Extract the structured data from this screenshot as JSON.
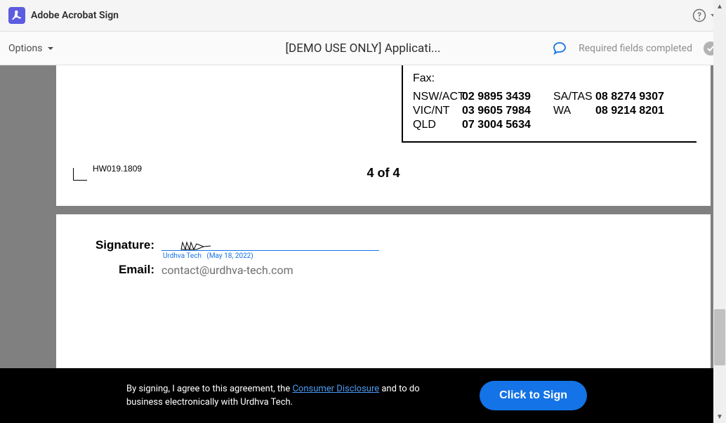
{
  "header": {
    "app_title": "Adobe Acrobat Sign"
  },
  "toolbar": {
    "options_label": "Options",
    "doc_title": "[DEMO USE ONLY] Applicati...",
    "status_text": "Required fields completed"
  },
  "document": {
    "fax_label": "Fax:",
    "fax_entries": [
      {
        "region": "NSW/ACT",
        "number": "02 9895 3439"
      },
      {
        "region": "VIC/NT",
        "number": "03 9605 7984"
      },
      {
        "region": "QLD",
        "number": "07 3004 5634"
      },
      {
        "region": "SA/TAS",
        "number": "08 8274 9307"
      },
      {
        "region": "WA",
        "number": "08 9214 8201"
      }
    ],
    "doc_code": "HW019.1809",
    "page_counter": "4 of 4",
    "signature_label": "Signature:",
    "signature_name": "Urdhva Tech",
    "signature_date": "(May 18, 2022)",
    "email_label": "Email:",
    "email_value": "contact@urdhva-tech.com"
  },
  "footer": {
    "pre_text": "By signing, I agree to this agreement, the ",
    "link_text": "Consumer Disclosure",
    "post_text": " and to do business electronically with Urdhva Tech.",
    "sign_button": "Click to Sign"
  }
}
